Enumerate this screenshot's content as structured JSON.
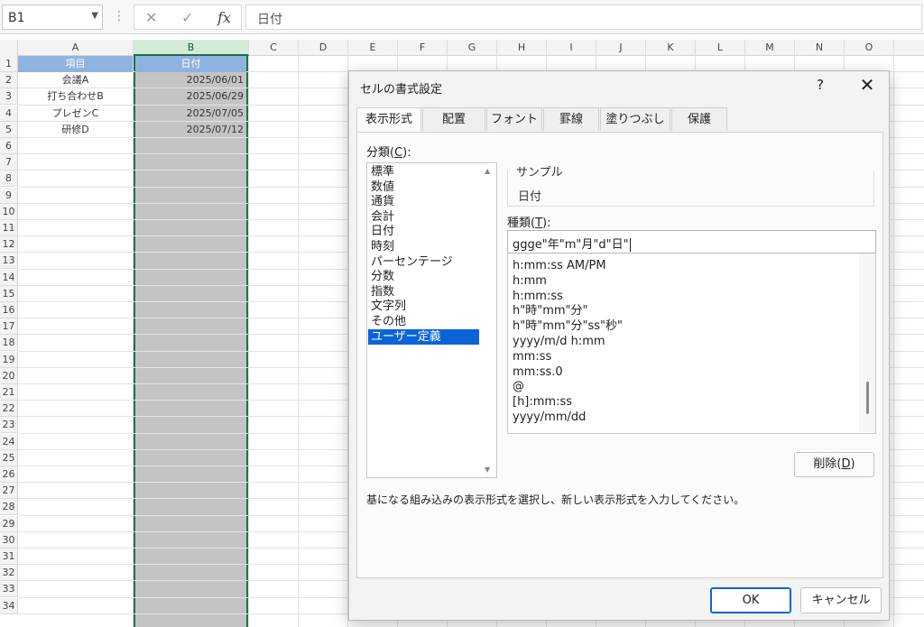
{
  "formula_bar": {
    "name_box": "B1",
    "cancel_icon": "close-icon",
    "enter_icon": "check-icon",
    "fx_label": "fx",
    "content": "日付"
  },
  "columns": [
    "A",
    "B",
    "C",
    "D",
    "E",
    "F",
    "G",
    "H",
    "I",
    "J",
    "K",
    "L",
    "M",
    "N",
    "O"
  ],
  "selected_column": "B",
  "rows": [
    "1",
    "2",
    "3",
    "4",
    "5",
    "6",
    "7",
    "8",
    "9",
    "10",
    "11",
    "12",
    "13",
    "14",
    "15",
    "16",
    "17",
    "18",
    "19",
    "20",
    "21",
    "22",
    "23",
    "24",
    "25",
    "26",
    "27",
    "28",
    "29",
    "30",
    "31",
    "32",
    "33",
    "34"
  ],
  "sheet": {
    "headers": [
      "項目",
      "日付"
    ],
    "data": [
      {
        "item": "会議A",
        "date": "2025/06/01"
      },
      {
        "item": "打ち合わせB",
        "date": "2025/06/29"
      },
      {
        "item": "プレゼンC",
        "date": "2025/07/05"
      },
      {
        "item": "研修D",
        "date": "2025/07/12"
      }
    ]
  },
  "dialog": {
    "title": "セルの書式設定",
    "help": "?",
    "close": "✕",
    "tabs": [
      "表示形式",
      "配置",
      "フォント",
      "罫線",
      "塗りつぶし",
      "保護"
    ],
    "active_tab": 0,
    "category_label": "分類(",
    "category_key": "C",
    "category_label_end": "):",
    "categories": [
      "標準",
      "数値",
      "通貨",
      "会計",
      "日付",
      "時刻",
      "パーセンテージ",
      "分数",
      "指数",
      "文字列",
      "その他",
      "ユーザー定義"
    ],
    "selected_category": 11,
    "sample_label": "サンプル",
    "sample_value": "日付",
    "type_label": "種類(",
    "type_key": "T",
    "type_label_end": "):",
    "type_value": "ggge\"年\"m\"月\"d\"日\"",
    "formats": [
      "h:mm:ss AM/PM",
      "h:mm",
      "h:mm:ss",
      "h\"時\"mm\"分\"",
      "h\"時\"mm\"分\"ss\"秒\"",
      "yyyy/m/d h:mm",
      "mm:ss",
      "mm:ss.0",
      "@",
      "[h]:mm:ss",
      "yyyy/mm/dd"
    ],
    "delete_label": "削除(",
    "delete_key": "D",
    "delete_label_end": ")",
    "hint": "基になる組み込みの表示形式を選択し、新しい表示形式を入力してください。",
    "ok": "OK",
    "cancel": "キャンセル"
  },
  "colors": {
    "accent": "#0a64d6",
    "selection_border": "#1e7145",
    "header_fill": "#8fb3df",
    "column_fill": "#c4c4c4"
  }
}
